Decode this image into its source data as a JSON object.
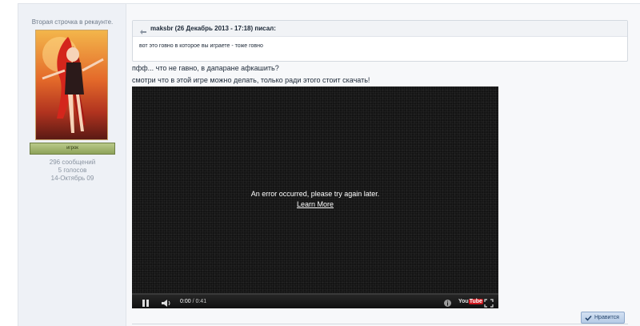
{
  "author": {
    "title": "Вторая строчка в рекаунте.",
    "group": "игрок",
    "posts": "296 сообщений",
    "votes": "5 голосов",
    "joined": "14-Октябрь 09"
  },
  "quote": {
    "header": "maksbr (26 Декабрь 2013 - 17:18) писал:",
    "text": "вот это говно в которое вы играете - тоже говно"
  },
  "post": {
    "line1": "пфф... что не гавно, в дапаране афкашить?",
    "line2": "смотри что в этой игре можно делать, только ради этого стоит скачать!"
  },
  "video": {
    "error_message": "An error occurred, please try again later.",
    "learn_more": "Learn More",
    "current_time": "0:00",
    "duration": "/ 0:41",
    "progress_fraction": 0,
    "logo_you": "You",
    "logo_tube": "Tube"
  },
  "actions": {
    "like_label": "Нравится"
  },
  "colors": {
    "accent": "#cc181e",
    "like_button": "#b6cbe6"
  }
}
